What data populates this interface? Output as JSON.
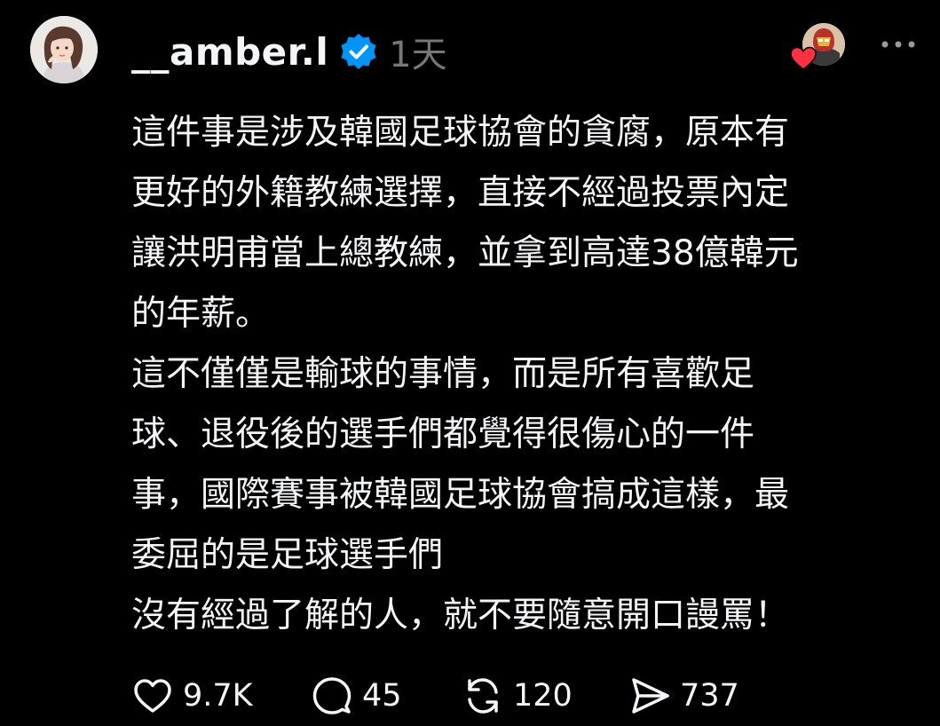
{
  "post": {
    "username": "__amber.l",
    "timestamp": "1天",
    "verified_color": "#0095f6",
    "like_badge_color": "#ff3040",
    "icons": {
      "avatar": "user-avatar",
      "verified": "verified-badge-icon",
      "liker": "liker-avatar",
      "heart_badge": "heart-icon",
      "more": "more-dots-icon"
    },
    "lines": [
      "這件事是涉及韓國足球協會的貪腐，原本有",
      "更好的外籍教練選擇，直接不經過投票內定",
      "讓洪明甫當上總教練，並拿到高達38億韓元",
      "的年薪。",
      "這不僅僅是輸球的事情，而是所有喜歡足",
      "球、退役後的選手們都覺得很傷心的一件",
      "事，國際賽事被韓國足球協會搞成這樣，最",
      "委屈的是足球選手們",
      "沒有經過了解的人，就不要隨意開口謾罵！"
    ]
  },
  "actions": {
    "like_count": "9.7K",
    "reply_count": "45",
    "repost_count": "120",
    "share_count": "737",
    "icons": [
      "heart-outline-icon",
      "comment-bubble-icon",
      "repost-arrows-icon",
      "send-arrow-icon"
    ]
  }
}
